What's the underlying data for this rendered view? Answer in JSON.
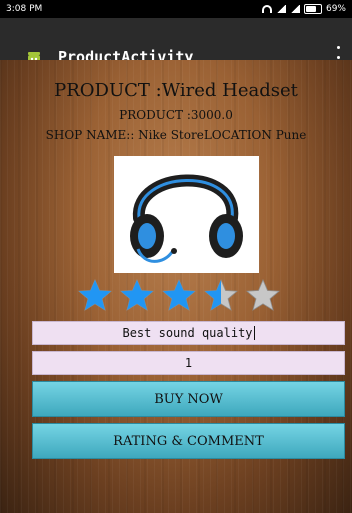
{
  "status_bar": {
    "time": "3:08 PM",
    "battery_text": "69%",
    "battery_level": 0.69
  },
  "action_bar": {
    "title": "ProductActivity",
    "icons": [
      "android-icon",
      "overflow-menu-icon"
    ]
  },
  "product": {
    "name_line": "PRODUCT :Wired Headset",
    "price_line": "PRODUCT :3000.0",
    "shop_line": "SHOP NAME::  Nike StoreLOCATION  Pune"
  },
  "rating": {
    "value": 3.5,
    "max": 5,
    "filled_color": "#2196f3",
    "empty_color": "#c7c7c7"
  },
  "form": {
    "comment_value": "Best sound quality",
    "quantity_value": "1"
  },
  "buttons": {
    "buy_now": "BUY NOW",
    "rating_comment": "RATING & COMMENT"
  },
  "colors": {
    "button": "#53bdd2",
    "input": "#efe0f2",
    "action_bar": "#2b2b2b"
  }
}
